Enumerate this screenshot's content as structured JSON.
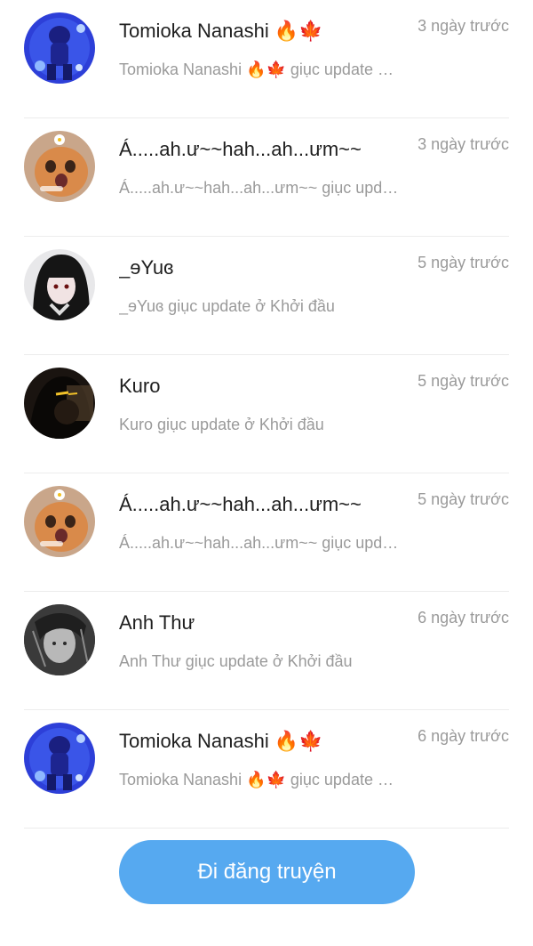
{
  "notifications": [
    {
      "name": "Tomioka Nanashi 🔥🍁",
      "preview": "Tomioka Nanashi 🔥🍁 giục update ở Khởi đầu",
      "time": "3 ngày trước",
      "avatar": "blue-figure-avatar"
    },
    {
      "name": "Á.....ah.ư~~hah...ah...ưm~~",
      "preview": "Á.....ah.ư~~hah...ah...ưm~~ giục update ở Khởi đầu",
      "time": "3 ngày trước",
      "avatar": "cat-avatar"
    },
    {
      "name": "_ɘYuɞ",
      "preview": "_ɘYuɞ giục update ở Khởi đầu",
      "time": "5 ngày trước",
      "avatar": "dark-hair-girl-avatar"
    },
    {
      "name": "Kuro",
      "preview": "Kuro giục update ở Khởi đầu",
      "time": "5 ngày trước",
      "avatar": "dark-figure-avatar"
    },
    {
      "name": "Á.....ah.ư~~hah...ah...ưm~~",
      "preview": "Á.....ah.ư~~hah...ah...ưm~~ giục update ở Khởi đầu",
      "time": "5 ngày trước",
      "avatar": "cat-avatar"
    },
    {
      "name": "Anh Thư",
      "preview": "Anh Thư giục update ở Khởi đầu",
      "time": "6 ngày trước",
      "avatar": "grayscale-sketch-avatar"
    },
    {
      "name": "Tomioka Nanashi 🔥🍁",
      "preview": "Tomioka Nanashi 🔥🍁 giục update ở Khởi đầu",
      "time": "6 ngày trước",
      "avatar": "blue-figure-avatar"
    }
  ],
  "cta": {
    "label": "Đi đăng truyện",
    "color": "#56a9f0"
  }
}
